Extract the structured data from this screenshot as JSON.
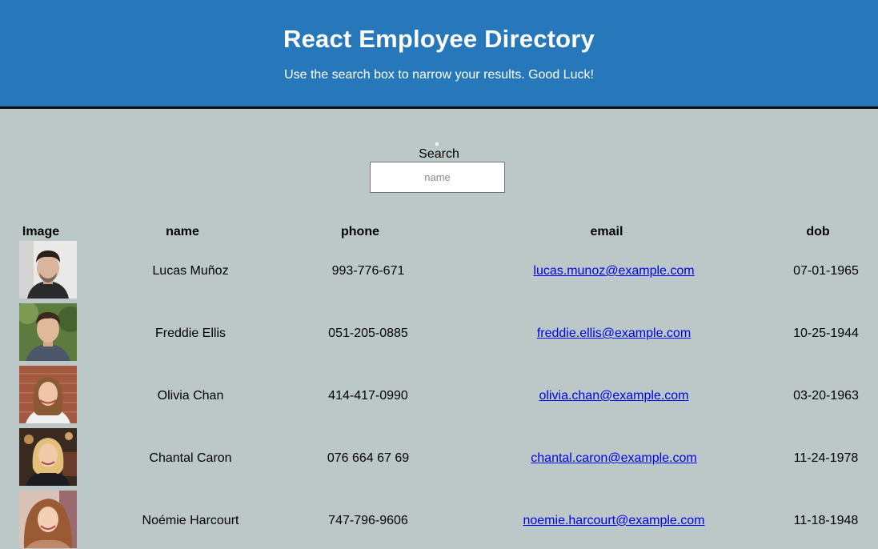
{
  "header": {
    "title": "React Employee Directory",
    "subtitle": "Use the search box to narrow your results. Good Luck!",
    "background_color": "#2778bb"
  },
  "search": {
    "label": "Search",
    "placeholder": "name",
    "value": ""
  },
  "table": {
    "columns": {
      "image": "Image",
      "name": "name",
      "phone": "phone",
      "email": "email",
      "dob": "dob"
    },
    "rows": [
      {
        "name": "Lucas Muñoz",
        "phone": "993-776-671",
        "email": "lucas.munoz@example.com",
        "dob": "07-01-1965"
      },
      {
        "name": "Freddie Ellis",
        "phone": "051-205-0885",
        "email": "freddie.ellis@example.com",
        "dob": "10-25-1944"
      },
      {
        "name": "Olivia Chan",
        "phone": "414-417-0990",
        "email": "olivia.chan@example.com",
        "dob": "03-20-1963"
      },
      {
        "name": "Chantal Caron",
        "phone": "076 664 67 69",
        "email": "chantal.caron@example.com",
        "dob": "11-24-1978"
      },
      {
        "name": "Noémie Harcourt",
        "phone": "747-796-9606",
        "email": "noemie.harcourt@example.com",
        "dob": "11-18-1948"
      }
    ]
  }
}
